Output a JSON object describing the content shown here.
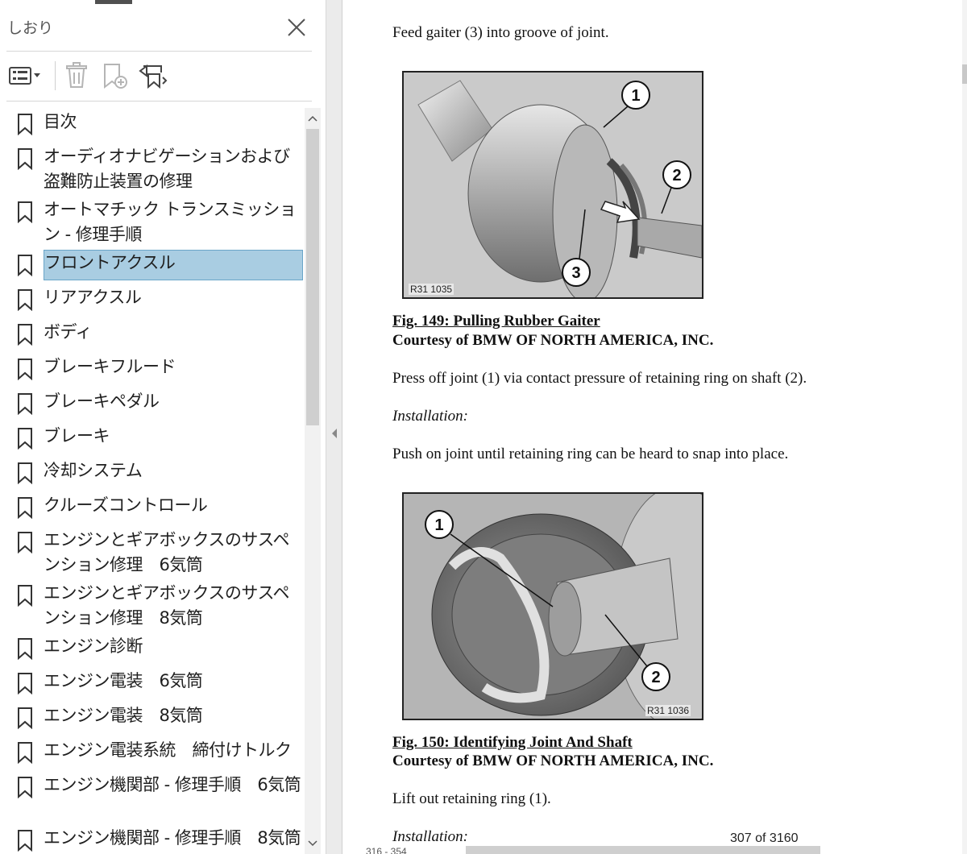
{
  "sidebar": {
    "title": "しおり",
    "toolbar": {
      "options_icon": "list-options-icon",
      "delete_icon": "trash-icon",
      "new_bookmark_icon": "add-bookmark-icon",
      "expand_icon": "expand-bookmark-icon"
    },
    "items": [
      {
        "label": "目次",
        "lines": 1,
        "selected": false
      },
      {
        "label": "オーディオナビゲーションおよび盗難防止装置の修理",
        "lines": 2,
        "selected": false
      },
      {
        "label": "オートマチック トランスミッション - 修理手順",
        "lines": 2,
        "selected": false
      },
      {
        "label": "フロントアクスル",
        "lines": 1,
        "selected": true
      },
      {
        "label": "リアアクスル",
        "lines": 1,
        "selected": false
      },
      {
        "label": "ボディ",
        "lines": 1,
        "selected": false
      },
      {
        "label": "ブレーキフルード",
        "lines": 1,
        "selected": false
      },
      {
        "label": "ブレーキペダル",
        "lines": 1,
        "selected": false
      },
      {
        "label": "ブレーキ",
        "lines": 1,
        "selected": false
      },
      {
        "label": "冷却システム",
        "lines": 1,
        "selected": false
      },
      {
        "label": "クルーズコントロール",
        "lines": 1,
        "selected": false
      },
      {
        "label": "エンジンとギアボックスのサスペンション修理　6気筒",
        "lines": 2,
        "selected": false
      },
      {
        "label": "エンジンとギアボックスのサスペンション修理　8気筒",
        "lines": 2,
        "selected": false
      },
      {
        "label": "エンジン診断",
        "lines": 1,
        "selected": false
      },
      {
        "label": "エンジン電装　6気筒",
        "lines": 1,
        "selected": false
      },
      {
        "label": "エンジン電装　8気筒",
        "lines": 1,
        "selected": false
      },
      {
        "label": "エンジン電装系統　締付けトルク",
        "lines": 1,
        "selected": false
      },
      {
        "label": "エンジン機関部 - 修理手順　6気筒",
        "lines": 2,
        "selected": false
      },
      {
        "label": "エンジン機関部 - 修理手順　8気筒",
        "lines": 2,
        "selected": false
      }
    ]
  },
  "document": {
    "para1": "Feed gaiter (3) into groove of joint.",
    "fig1": {
      "code": "R31 1035",
      "callouts": [
        "1",
        "2",
        "3"
      ],
      "caption_title": "Fig. 149: Pulling Rubber Gaiter",
      "caption_credit": "Courtesy of BMW OF NORTH AMERICA, INC."
    },
    "para2": "Press off joint (1) via contact pressure of retaining ring on shaft (2).",
    "installation1": "Installation:",
    "para3": "Push on joint until retaining ring can be heard to snap into place.",
    "fig2": {
      "code": "R31 1036",
      "callouts": [
        "1",
        "2"
      ],
      "caption_title": "Fig. 150: Identifying Joint And Shaft",
      "caption_credit": "Courtesy of BMW OF NORTH AMERICA, INC."
    },
    "para4": "Lift out retaining ring (1).",
    "installation2": "Installation:",
    "page_counter": "307 of 3160",
    "page_label_fragment": "316 - 354"
  },
  "colors": {
    "selected_bg": "#a9cde2",
    "selected_border": "#6aa5c8",
    "text": "#1f1f1f"
  }
}
